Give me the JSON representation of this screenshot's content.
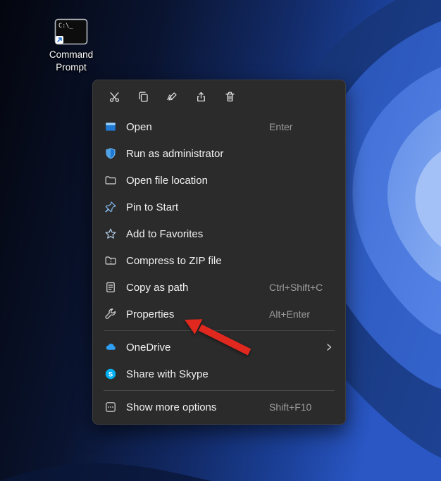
{
  "desktop": {
    "icon_label": "Command Prompt",
    "icon_terminal_text": "C:\\_"
  },
  "menu": {
    "toolbar": [
      {
        "icon": "cut-icon"
      },
      {
        "icon": "copy-icon"
      },
      {
        "icon": "rename-icon"
      },
      {
        "icon": "share-icon"
      },
      {
        "icon": "delete-icon"
      }
    ],
    "items": [
      {
        "label": "Open",
        "shortcut": "Enter",
        "icon": "open-window-icon"
      },
      {
        "label": "Run as administrator",
        "shortcut": "",
        "icon": "admin-shield-icon"
      },
      {
        "label": "Open file location",
        "shortcut": "",
        "icon": "folder-icon"
      },
      {
        "label": "Pin to Start",
        "shortcut": "",
        "icon": "pin-icon"
      },
      {
        "label": "Add to Favorites",
        "shortcut": "",
        "icon": "star-icon"
      },
      {
        "label": "Compress to ZIP file",
        "shortcut": "",
        "icon": "zip-folder-icon"
      },
      {
        "label": "Copy as path",
        "shortcut": "Ctrl+Shift+C",
        "icon": "copy-path-icon"
      },
      {
        "label": "Properties",
        "shortcut": "Alt+Enter",
        "icon": "wrench-icon"
      },
      {
        "label": "OneDrive",
        "shortcut": "",
        "icon": "onedrive-cloud-icon",
        "has_submenu": true
      },
      {
        "label": "Share with Skype",
        "shortcut": "",
        "icon": "skype-icon"
      },
      {
        "label": "Show more options",
        "shortcut": "Shift+F10",
        "icon": "more-options-icon"
      }
    ],
    "colors": {
      "menu_bg": "#2b2b2b",
      "shortcut_text": "#9d9d9d",
      "accent_blue": "#2f9ef3"
    }
  },
  "annotation": {
    "arrow_color": "#e0281e",
    "points_to": "Properties"
  }
}
